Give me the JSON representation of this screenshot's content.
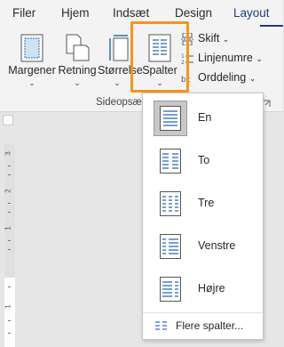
{
  "tabs": [
    {
      "label": "Filer"
    },
    {
      "label": "Hjem"
    },
    {
      "label": "Indsæt"
    },
    {
      "label": "Design"
    },
    {
      "label": "Layout",
      "active": true
    }
  ],
  "ribbon": {
    "margins_label": "Margener",
    "orientation_label": "Retning",
    "size_label": "Størrelse",
    "columns_label": "Spalter",
    "breaks_label": "Skift",
    "line_numbers_label": "Linjenumre",
    "hyphenation_label": "Orddeling",
    "group_label": "Sideopsæt"
  },
  "ruler": {
    "numbers": [
      "3",
      "2",
      "1",
      "1"
    ]
  },
  "columns_menu": {
    "items": [
      {
        "label": "En",
        "selected": true
      },
      {
        "label": "To"
      },
      {
        "label": "Tre"
      },
      {
        "label": "Venstre"
      },
      {
        "label": "Højre"
      }
    ],
    "more_label": "Flere spalter..."
  },
  "colors": {
    "accent": "#1f3f7a",
    "highlight": "#f7941d",
    "icon_blue": "#2b6cb8"
  }
}
